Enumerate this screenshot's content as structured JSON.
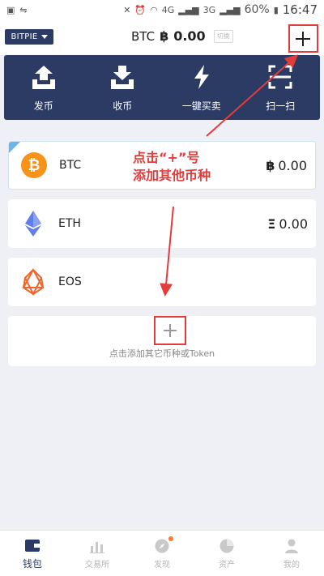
{
  "status_bar": {
    "battery": "60%",
    "time": "16:47",
    "network_4g": "4G",
    "network_3g": "3G"
  },
  "header": {
    "wallet_name": "BITPIE",
    "balance_unit": "BTC",
    "balance_symbol": "฿",
    "balance_value": "0.00",
    "switch_label": "切换"
  },
  "actions": [
    {
      "label": "发币",
      "icon": "send-icon"
    },
    {
      "label": "收币",
      "icon": "receive-icon"
    },
    {
      "label": "一键买卖",
      "icon": "lightning-icon"
    },
    {
      "label": "扫一扫",
      "icon": "scan-icon"
    }
  ],
  "coins": [
    {
      "name": "BTC",
      "symbol": "฿",
      "balance": "0.00",
      "color": "#f7931a"
    },
    {
      "name": "ETH",
      "symbol": "Ξ",
      "balance": "0.00",
      "color": "#627eea"
    },
    {
      "name": "EOS",
      "symbol": "",
      "balance": "",
      "color": "#f0642d"
    }
  ],
  "add_coin": {
    "label": "点击添加其它币种或Token"
  },
  "annotation": {
    "line1": "点击“+”号",
    "line2": "添加其他币种"
  },
  "nav": [
    {
      "label": "钱包",
      "active": true
    },
    {
      "label": "交易所",
      "active": false
    },
    {
      "label": "发现",
      "active": false
    },
    {
      "label": "资产",
      "active": false
    },
    {
      "label": "我的",
      "active": false
    }
  ],
  "colors": {
    "brand": "#2c3b63",
    "annotation": "#e33c3c",
    "btc": "#f7931a",
    "eos": "#f0642d"
  }
}
